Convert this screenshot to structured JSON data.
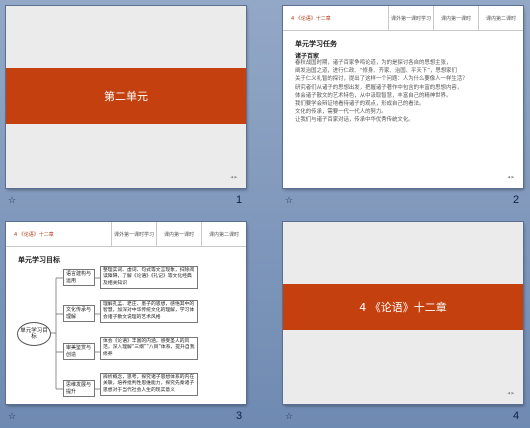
{
  "slides": [
    {
      "number": "1",
      "title": "第二单元"
    },
    {
      "number": "2",
      "header": {
        "title": "4 《论语》十二章",
        "nav": [
          "课外第一课时学习",
          "课内第一课时",
          "课内第二课时"
        ]
      },
      "section": "单元学习任务",
      "subtitle": "诸子百家",
      "paragraphs": [
        "春秋战国时期，诸子百家争鸣论道，为的是探讨各自的思想主张，",
        "阐发治国之道，进行仁政、“修身、齐家、治国、平天下”，思想家们",
        "关于仁义礼智的探讨，提出了这样一个问题：人为什么要像人一样生活？",
        "研究者们从诸子的思想出发，把握诸子著作中包含的丰富的思想内容，",
        "体会诸子散文的艺术特色，从中汲取智慧，丰富自己的精神世界。",
        "我们要学会辩证地看待诸子的观点，形成自己的看法。",
        "文化的传承，需要一代一代人的努力。",
        "让我们与诸子百家对话，传承中华优秀传统文化。"
      ]
    },
    {
      "number": "3",
      "header": {
        "title": "4 《论语》十二章",
        "nav": [
          "课外第一课时学习",
          "课内第一课时",
          "课内第二课时"
        ]
      },
      "section": "单元学习目标",
      "center": "单元学习目标",
      "categories": [
        "语言建构与运用",
        "文化传承与理解",
        "审美鉴赏与创造",
        "思维发展与提升"
      ],
      "descriptions": [
        "整理实词、虚词、句式等文言现象，扫除阅读障碍，了解《论语》《礼记》等文化经典及相关知识",
        "理解孔孟、老庄、墨子的思想，感悟其中的智慧，加深对中华传统文化的理解，学习体会诸子散文说理的艺术风格",
        "体会《论语》丰富的内涵，感受圣人的风范，深入理解“三纲”“八目”体系，提升自我修养",
        "辨析概念，思考，探究诸子思想体系的内在关联，培养批判性思维能力，探究先秦诸子思想对于当代社会人生的现实意义"
      ]
    },
    {
      "number": "4",
      "title": "4 《论语》十二章"
    }
  ]
}
